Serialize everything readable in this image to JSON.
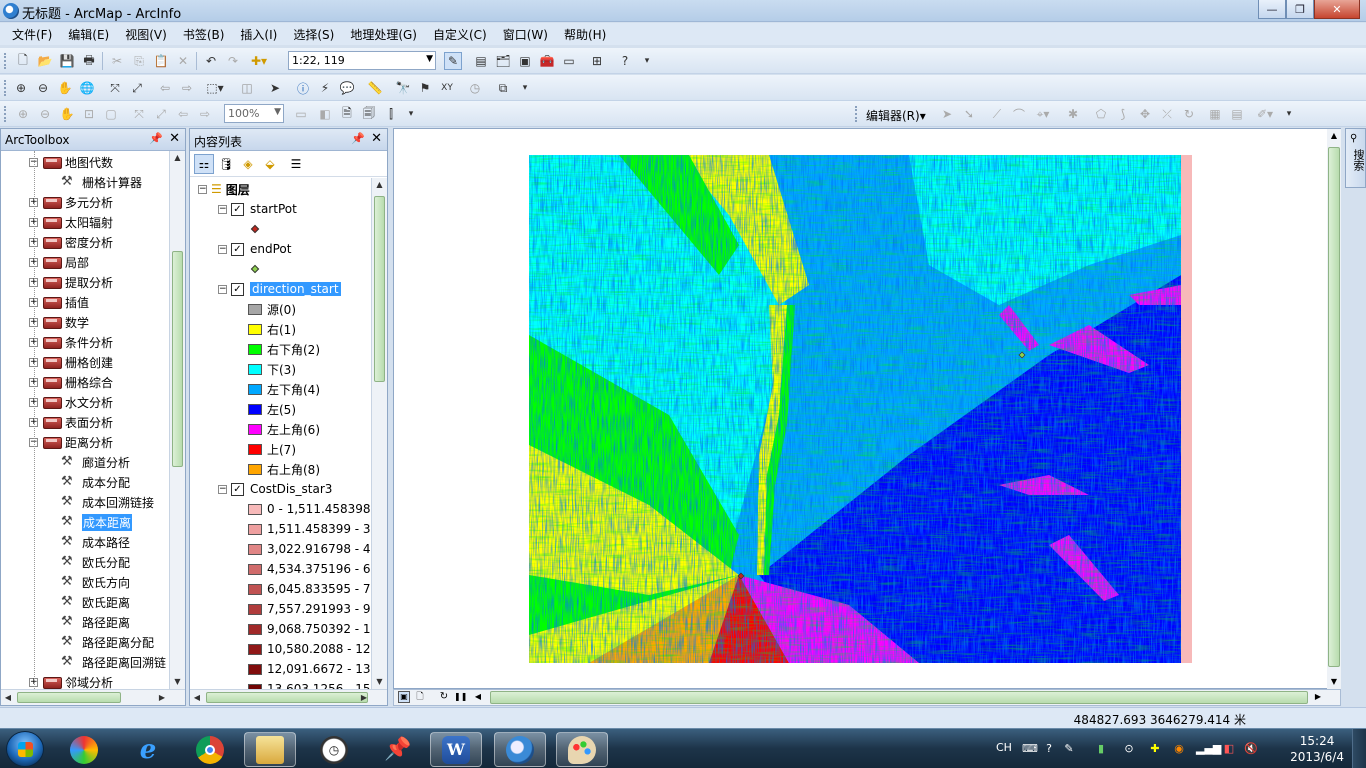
{
  "window": {
    "title": "无标题 - ArcMap - ArcInfo",
    "min": "—",
    "max": "❐",
    "close": "✕"
  },
  "menu": [
    "文件(F)",
    "编辑(E)",
    "视图(V)",
    "书签(B)",
    "插入(I)",
    "选择(S)",
    "地理处理(G)",
    "自定义(C)",
    "窗口(W)",
    "帮助(H)"
  ],
  "toolbar": {
    "scale": "1:22, 119",
    "zoom_percent": "100%",
    "editor_label": "编辑器(R)▾"
  },
  "toolbox": {
    "title": "ArcToolbox",
    "items": [
      {
        "label": "地图代数",
        "kind": "toolset",
        "expanded": true,
        "level": 1
      },
      {
        "label": "栅格计算器",
        "kind": "tool",
        "level": 2
      },
      {
        "label": "多元分析",
        "kind": "toolset",
        "level": 1
      },
      {
        "label": "太阳辐射",
        "kind": "toolset",
        "level": 1
      },
      {
        "label": "密度分析",
        "kind": "toolset",
        "level": 1
      },
      {
        "label": "局部",
        "kind": "toolset",
        "level": 1
      },
      {
        "label": "提取分析",
        "kind": "toolset",
        "level": 1
      },
      {
        "label": "插值",
        "kind": "toolset",
        "level": 1
      },
      {
        "label": "数学",
        "kind": "toolset",
        "level": 1
      },
      {
        "label": "条件分析",
        "kind": "toolset",
        "level": 1
      },
      {
        "label": "栅格创建",
        "kind": "toolset",
        "level": 1
      },
      {
        "label": "栅格综合",
        "kind": "toolset",
        "level": 1
      },
      {
        "label": "水文分析",
        "kind": "toolset",
        "level": 1
      },
      {
        "label": "表面分析",
        "kind": "toolset",
        "level": 1
      },
      {
        "label": "距离分析",
        "kind": "toolset",
        "expanded": true,
        "level": 1
      },
      {
        "label": "廊道分析",
        "kind": "tool",
        "level": 2
      },
      {
        "label": "成本分配",
        "kind": "tool",
        "level": 2
      },
      {
        "label": "成本回溯链接",
        "kind": "tool",
        "level": 2
      },
      {
        "label": "成本距离",
        "kind": "tool",
        "level": 2,
        "selected": true
      },
      {
        "label": "成本路径",
        "kind": "tool",
        "level": 2
      },
      {
        "label": "欧氏分配",
        "kind": "tool",
        "level": 2
      },
      {
        "label": "欧氏方向",
        "kind": "tool",
        "level": 2
      },
      {
        "label": "欧氏距离",
        "kind": "tool",
        "level": 2
      },
      {
        "label": "路径距离",
        "kind": "tool",
        "level": 2
      },
      {
        "label": "路径距离分配",
        "kind": "tool",
        "level": 2
      },
      {
        "label": "路径距离回溯链",
        "kind": "tool",
        "level": 2
      },
      {
        "label": "邻域分析",
        "kind": "toolset",
        "level": 1
      }
    ]
  },
  "toc": {
    "title": "内容列表",
    "root": "图层",
    "layers": [
      {
        "name": "startPot",
        "symbol_color": "#c0281e"
      },
      {
        "name": "endPot",
        "symbol_color": "#8fd14f"
      },
      {
        "name": "direction_start",
        "selected": true,
        "classes": [
          {
            "label": "源(0)",
            "color": "#a6a6a6"
          },
          {
            "label": "右(1)",
            "color": "#ffff00"
          },
          {
            "label": "右下角(2)",
            "color": "#00ff00"
          },
          {
            "label": "下(3)",
            "color": "#00ffff"
          },
          {
            "label": "左下角(4)",
            "color": "#00a8ff"
          },
          {
            "label": "左(5)",
            "color": "#0000ff"
          },
          {
            "label": "左上角(6)",
            "color": "#ff00ff"
          },
          {
            "label": "上(7)",
            "color": "#ff0000"
          },
          {
            "label": "右上角(8)",
            "color": "#ffa500"
          }
        ]
      },
      {
        "name": "CostDis_star3",
        "classes": [
          {
            "label": "0 - 1,511.458398",
            "color": "#f7b9b9"
          },
          {
            "label": "1,511.458399 - 3,0",
            "color": "#ee9f9f"
          },
          {
            "label": "3,022.916798 - 4,5",
            "color": "#e08585"
          },
          {
            "label": "4,534.375196 - 6,0",
            "color": "#d06b6b"
          },
          {
            "label": "6,045.833595 - 7,5",
            "color": "#c05252"
          },
          {
            "label": "7,557.291993 - 9,0",
            "color": "#b03c3c"
          },
          {
            "label": "9,068.750392 - 10",
            "color": "#a02828"
          },
          {
            "label": "10,580.2088 - 12,0",
            "color": "#901818"
          },
          {
            "label": "12,091.6672 - 13,6",
            "color": "#800c0c"
          },
          {
            "label": "13,603.1256 - 15",
            "color": "#700404"
          }
        ]
      }
    ]
  },
  "search_tab": "搜索",
  "status": {
    "coords": "484827.693  3646279.414 米"
  },
  "taskbar": {
    "time": "15:24",
    "date": "2013/6/4",
    "ime": "CH"
  }
}
